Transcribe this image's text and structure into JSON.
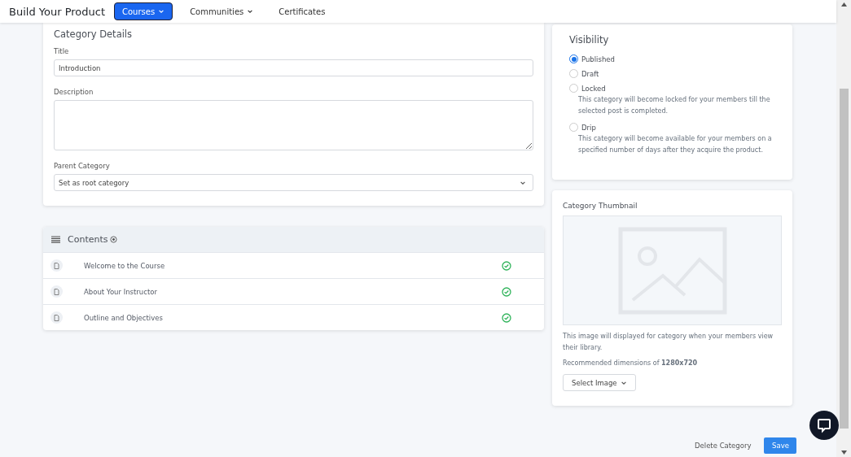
{
  "nav": {
    "brand": "Build Your Product",
    "items": [
      {
        "label": "Courses",
        "selected": true,
        "dropdown": true
      },
      {
        "label": "Communities",
        "selected": false,
        "dropdown": true
      },
      {
        "label": "Certificates",
        "selected": false,
        "dropdown": false
      }
    ]
  },
  "details": {
    "heading": "Category Details",
    "title_label": "Title",
    "title_value": "Introduction",
    "description_label": "Description",
    "parent_label": "Parent Category",
    "parent_value": "Set as root category"
  },
  "contents": {
    "heading": "Contents",
    "items": [
      {
        "title": "Welcome to the Course",
        "done": true
      },
      {
        "title": "About Your Instructor",
        "done": true
      },
      {
        "title": "Outline and Objectives",
        "done": true
      }
    ]
  },
  "visibility": {
    "heading": "Visibility",
    "options": [
      {
        "label": "Published",
        "selected": true
      },
      {
        "label": "Draft",
        "selected": false
      },
      {
        "label": "Locked",
        "selected": false,
        "note": "This category will become locked for your members till the selected post is completed."
      },
      {
        "label": "Drip",
        "selected": false,
        "note": "This category will become available for your members on a specified number of days after they acquire the product."
      }
    ]
  },
  "thumbnail": {
    "heading": "Category Thumbnail",
    "note": "This image will displayed for category when your members view their library.",
    "dimensions": "Recommended dimensions of **1280x720**",
    "button": "Select Image"
  },
  "actions": {
    "delete": "Delete Category",
    "save": "Save"
  }
}
